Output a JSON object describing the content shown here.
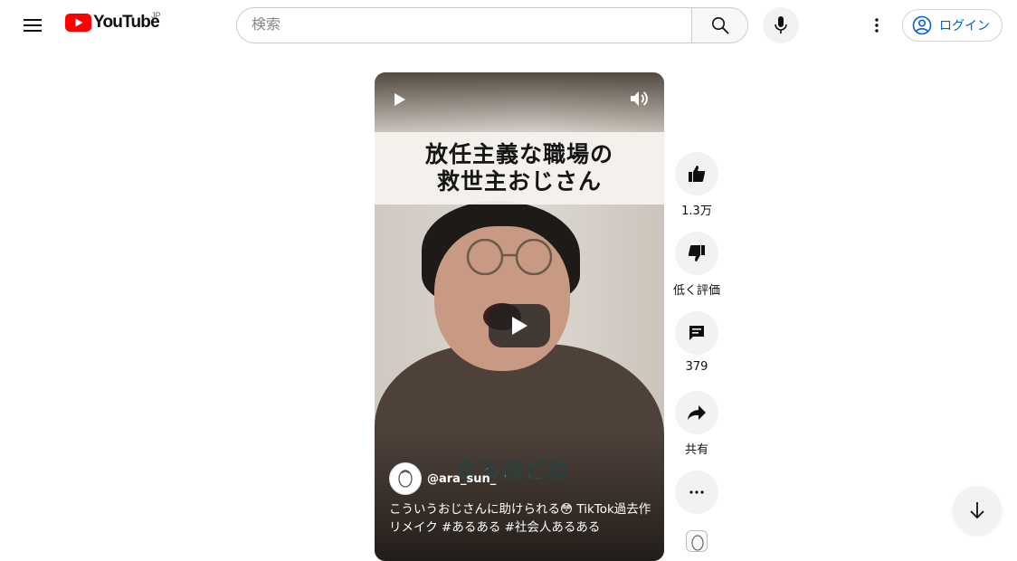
{
  "header": {
    "logo_text": "YouTube",
    "region_code": "JP",
    "search_placeholder": "検索",
    "search_value": "",
    "login_label": "ログイン",
    "brand_color": "#ff0000",
    "accent_color": "#065fd4"
  },
  "short": {
    "caption_line1": "放任主義な職場の",
    "caption_line2": "救世主おじさん",
    "subtitle": "なるほどね",
    "channel_handle": "@ara_sun_",
    "title": "こういうおじさんに助けられる😳 TikTok過去作リメイク #あるある #社会人あるある"
  },
  "actions": {
    "like_count": "1.3万",
    "dislike_label": "低く評価",
    "comment_count": "379",
    "share_label": "共有"
  },
  "icons": [
    "menu-icon",
    "youtube-logo-icon",
    "search-icon",
    "mic-icon",
    "more-vert-icon",
    "account-circle-icon",
    "play-icon",
    "volume-icon",
    "thumb-up-icon",
    "thumb-down-icon",
    "comment-icon",
    "share-icon",
    "more-horiz-icon",
    "arrow-down-icon"
  ]
}
